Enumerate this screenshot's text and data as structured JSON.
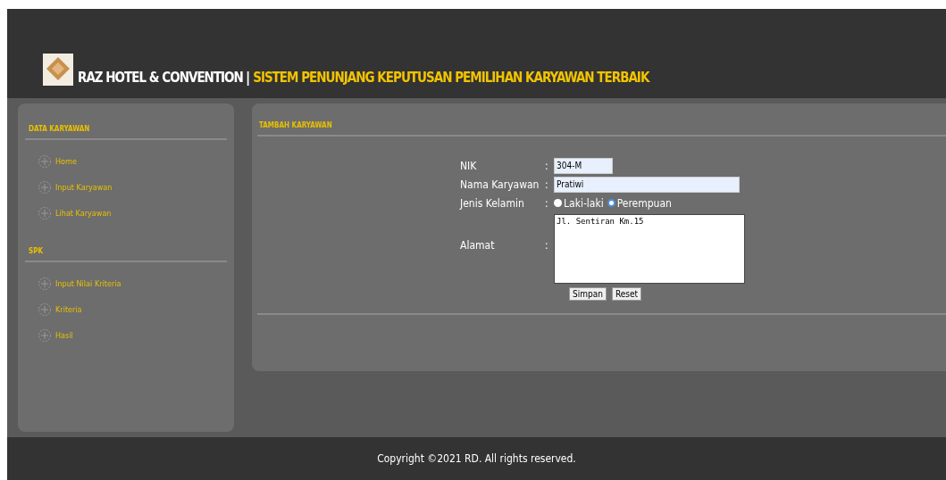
{
  "header": {
    "brand": "RAZ HOTEL & CONVENTION",
    "separator": "|",
    "title": "SISTEM PENUNJANG KEPUTUSAN PEMILIHAN KARYAWAN TERBAIK"
  },
  "sidebar": {
    "sections": [
      {
        "heading": "DATA KARYAWAN",
        "items": [
          {
            "label": "Home"
          },
          {
            "label": "Input Karyawan"
          },
          {
            "label": "Lihat Karyawan"
          }
        ]
      },
      {
        "heading": "SPK",
        "items": [
          {
            "label": "Input Nilai Kriteria"
          },
          {
            "label": "Kriteria"
          },
          {
            "label": "Hasil"
          }
        ]
      }
    ]
  },
  "panel": {
    "title": "TAMBAH KARYAWAN"
  },
  "form": {
    "fields": [
      {
        "kind": "text",
        "label": "NIK",
        "value": "304-M",
        "wide": false
      },
      {
        "kind": "text",
        "label": "Nama Karyawan",
        "value": "Pratiwi",
        "wide": true
      },
      {
        "kind": "radio",
        "label": "Jenis Kelamin",
        "options": [
          {
            "label": "Laki-laki",
            "selected": false
          },
          {
            "label": "Perempuan",
            "selected": true
          }
        ]
      },
      {
        "kind": "textarea",
        "label": "Alamat",
        "value": "Jl. Sentiran Km.15"
      }
    ],
    "separator": ":",
    "buttons": [
      "Simpan",
      "Reset"
    ]
  },
  "footer": {
    "text": "Copyright ©2021 RD. All rights reserved."
  }
}
